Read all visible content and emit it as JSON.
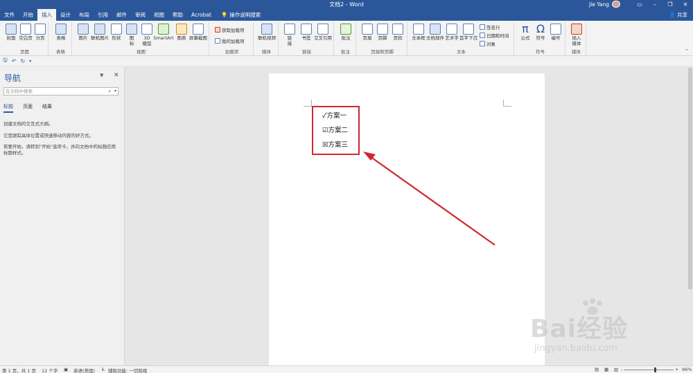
{
  "window": {
    "title": "文档2 - Word",
    "user_name": "Jie Yang",
    "controls": {
      "minimize": "–",
      "restore": "❐",
      "close": "✕"
    }
  },
  "tabs": [
    {
      "label": "文件"
    },
    {
      "label": "开始"
    },
    {
      "label": "插入",
      "active": true
    },
    {
      "label": "设计"
    },
    {
      "label": "布局"
    },
    {
      "label": "引用"
    },
    {
      "label": "邮件"
    },
    {
      "label": "审阅"
    },
    {
      "label": "视图"
    },
    {
      "label": "帮助"
    },
    {
      "label": "Acrobat"
    }
  ],
  "tell_me": "操作说明搜索",
  "share": "共享",
  "ribbon": {
    "groups": {
      "pages": "页面",
      "tables": "表格",
      "illustrations": "插图",
      "addins": "加载项",
      "media": "媒体",
      "links": "链接",
      "comments": "批注",
      "header_footer": "页眉和页脚",
      "text": "文本",
      "symbols": "符号",
      "embed": "媒体"
    },
    "buttons": {
      "cover": "封面",
      "blank": "空白页",
      "pagebreak": "分页",
      "table": "表格",
      "picture": "图片",
      "online_picture": "联机图片",
      "shapes": "形状",
      "icons": "图\n标",
      "model3d": "3D\n模型",
      "smartart": "SmartArt",
      "chart": "图表",
      "screenshot": "屏幕截图",
      "get_addins": "获取加载项",
      "my_addins": "我的加载项",
      "online_video": "联机视频",
      "link": "链\n接",
      "bookmark": "书签",
      "crossref": "交叉引用",
      "comment": "批注",
      "header": "页眉",
      "footer": "页脚",
      "pagenum": "页码",
      "textbox": "文本框",
      "quickparts": "文档部件",
      "wordart": "艺术字",
      "dropcap": "首字下沉",
      "signature": "签名行",
      "datetime": "日期和时间",
      "object": "对象",
      "equation": "公式",
      "symbol": "符号",
      "number": "编号",
      "embed_media": "插入\n媒体"
    }
  },
  "nav": {
    "title": "导航",
    "search_placeholder": "在文档中搜索",
    "tabs": [
      {
        "label": "标题",
        "active": true
      },
      {
        "label": "页面"
      },
      {
        "label": "结果"
      }
    ],
    "text_1": "创建文档的交互式大纲。",
    "text_2": "它是跟踪具体位置或快速移动内容的好方式。",
    "text_3": "若要开始，请转到\"开始\"选项卡，并向文档中的标题应用标题样式。"
  },
  "document": {
    "options": [
      {
        "mark": "✓",
        "text": "方案一"
      },
      {
        "mark": "☑",
        "text": "方案二"
      },
      {
        "mark": "☒",
        "text": "方案三"
      }
    ]
  },
  "status": {
    "page": "第 1 页，共 1 页",
    "words": "12 个字",
    "language": "英语(美国)",
    "accessibility": "辅助功能: 一切就绪",
    "zoom": "96%",
    "zoom_minus": "-",
    "zoom_plus": "+"
  },
  "watermark": {
    "text": "Bai经验",
    "url": "jingyan.baidu.com"
  },
  "colors": {
    "accent": "#2b579a",
    "highlight": "#d0262e"
  }
}
